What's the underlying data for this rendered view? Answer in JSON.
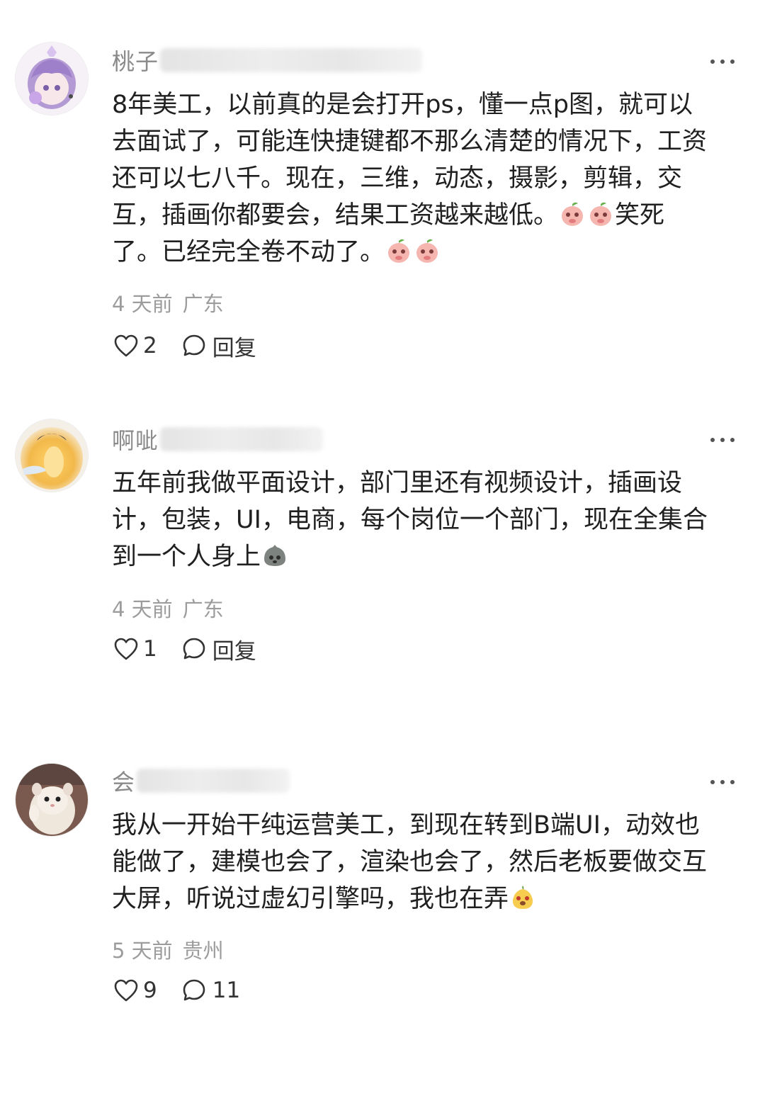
{
  "comments": [
    {
      "username_visible": "桃子",
      "body_lines": [
        "8年美工，以前真的是会打开ps，懂一点p图，就可以",
        "去面试了，可能连快捷键都不那么清楚的情况下，工资",
        "还可以七八千。现在，三维，动态，摄影，剪辑，交",
        "互，插画你都要会，结果工资越来越低。",
        "了。已经完全卷不动了。"
      ],
      "inline_text": "笑死",
      "emoji_names": [
        "peach-face-emoji",
        "peach-face-emoji",
        "peach-face-emoji",
        "peach-face-emoji"
      ],
      "time": "4 天前",
      "location": "广东",
      "like_count": "2",
      "reply_label": "回复"
    },
    {
      "username_visible": "啊呲",
      "body_lines": [
        "五年前我做平面设计，部门里还有视频设计，插画设",
        "计，包装，UI，电商，每个岗位一个部门，现在全集合",
        "到一个人身上"
      ],
      "emoji_names": [
        "gray-blob-emoji"
      ],
      "time": "4 天前",
      "location": "广东",
      "like_count": "1",
      "reply_label": "回复"
    },
    {
      "username_visible": "会",
      "body_lines": [
        "我从一开始干纯运营美工，到现在转到B端UI，动效也",
        "能做了，建模也会了，渲染也会了，然后老板要做交互",
        "大屏，听说过虚幻引擎吗，我也在弄"
      ],
      "emoji_names": [
        "yellow-pear-emoji"
      ],
      "time": "5 天前",
      "location": "贵州",
      "like_count": "9",
      "reply_count": "11"
    }
  ],
  "colors": {
    "meta_gray": "#9c9c9c",
    "username_gray": "#8a8a8a",
    "text": "#202020",
    "icon": "#333333"
  }
}
